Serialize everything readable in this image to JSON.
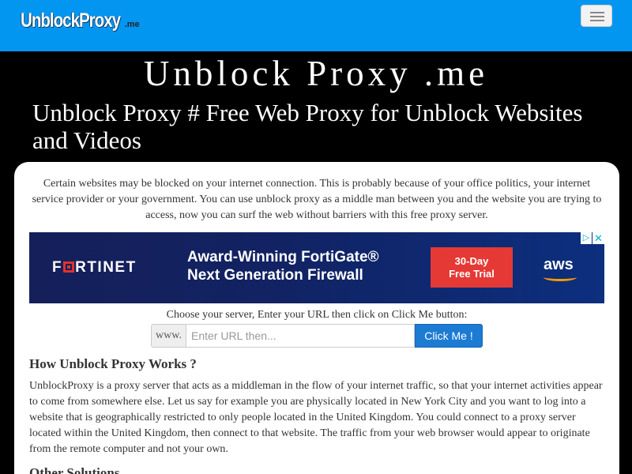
{
  "header": {
    "logo_text": "UnblockProxy",
    "logo_tld": ".me",
    "menu_icon": "hamburger-icon",
    "brand_color": "#0396f0"
  },
  "hero": {
    "site_title": "Unblock Proxy .me",
    "subtitle": "Unblock Proxy # Free Web Proxy for Unblock Websites and Videos"
  },
  "intro": "Certain websites may be blocked on your internet connection. This is probably because of your office politics, your internet service provider or your government. You can use unblock proxy as a middle man between you and the website you are trying to access, now you can surf the web without barriers with this free proxy server.",
  "ad": {
    "brand_pre": "F",
    "brand_post": "RTINET",
    "headline_line1": "Award-Winning FortiGate®",
    "headline_line2": "Next Generation Firewall",
    "cta_line1": "30-Day",
    "cta_line2": "Free Trial",
    "partner": "aws",
    "adchoices_icon": "adchoices-icon",
    "close_icon": "close-icon",
    "choice_glyph": "▷",
    "close_glyph": "✕"
  },
  "form": {
    "label": "Choose your server, Enter your URL then click on Click Me button:",
    "prefix": "www.",
    "placeholder": "Enter URL then...",
    "button": "Click Me !",
    "button_color": "#1c7bd3"
  },
  "sections": {
    "how_title": "How Unblock Proxy Works ?",
    "how_body": "UnblockProxy is a proxy server that acts as a middleman in the flow of your internet traffic, so that your internet activities appear to come from somewhere else. Let us say for example you are physically located in New York City and you want to log into a website that is geographically restricted to only people located in the United Kingdom. You could connect to a proxy server located within the United Kingdom, then connect to that website. The traffic from your web browser would appear to originate from the remote computer and not your own.",
    "other_title": "Other Solutions"
  }
}
